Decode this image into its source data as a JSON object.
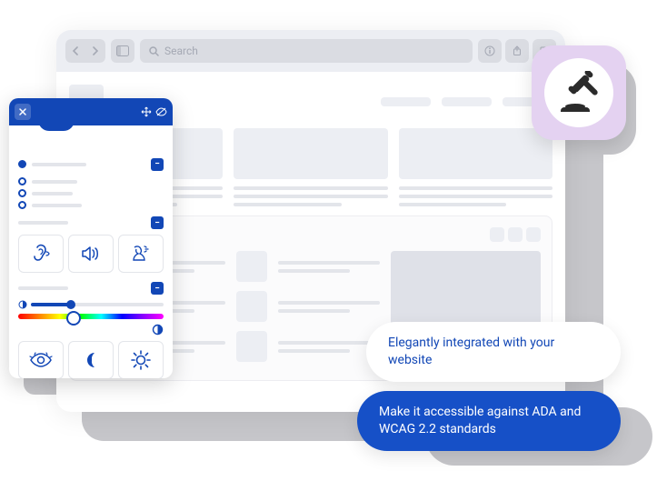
{
  "browser": {
    "search_placeholder": "Search"
  },
  "widget": {
    "icons_row1": [
      "ear-icon",
      "speaker-icon",
      "voice-icon"
    ],
    "icons_row2": [
      "eye-icon",
      "moon-icon",
      "sun-icon"
    ]
  },
  "gavel_badge": {
    "icon": "gavel-icon"
  },
  "bubbles": {
    "white": "Elegantly integrated with your website",
    "blue": "Make it accessible against ADA and WCAG 2.2 standards"
  },
  "colors": {
    "primary": "#1247b6",
    "badge_bg": "#e4d2f1",
    "shadow": "#c6c6ca"
  }
}
